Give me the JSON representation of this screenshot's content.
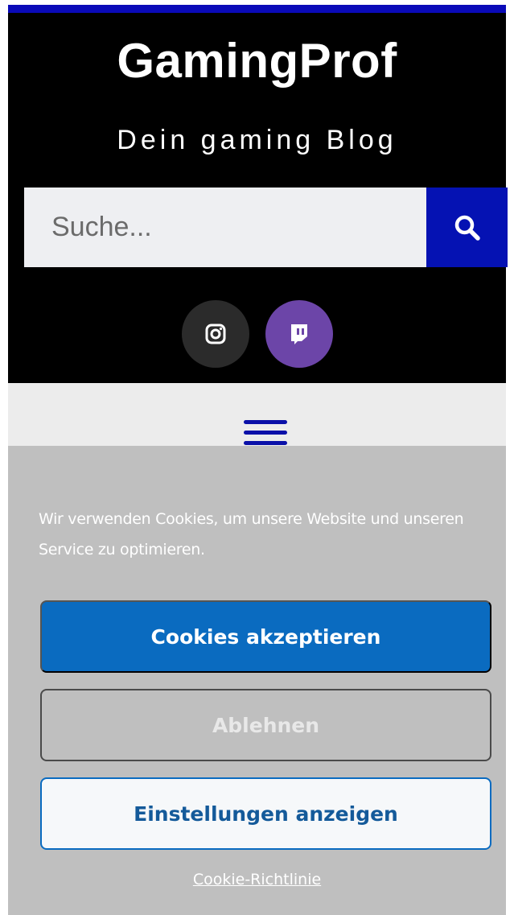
{
  "header": {
    "site_title": "GamingProf",
    "tagline": "Dein gaming Blog"
  },
  "search": {
    "placeholder": "Suche...",
    "button_icon": "search-icon"
  },
  "social": [
    {
      "name": "Instagram",
      "icon": "instagram-icon",
      "bg": "#2b2b2b"
    },
    {
      "name": "Twitch",
      "icon": "twitch-icon",
      "bg": "#6c45a8"
    }
  ],
  "nav": {
    "menu_icon": "hamburger-menu-icon"
  },
  "cookie_banner": {
    "text": "Wir verwenden Cookies, um unsere Website und unseren Service zu optimieren.",
    "accept_label": "Cookies akzeptieren",
    "deny_label": "Ablehnen",
    "settings_label": "Einstellungen anzeigen",
    "policy_link": "Cookie-Richtlinie"
  },
  "colors": {
    "header_bg": "#000000",
    "accent_blue": "#0512b3",
    "cookie_bg": "#bfbfbf",
    "accept_bg": "#0a6bc0"
  }
}
